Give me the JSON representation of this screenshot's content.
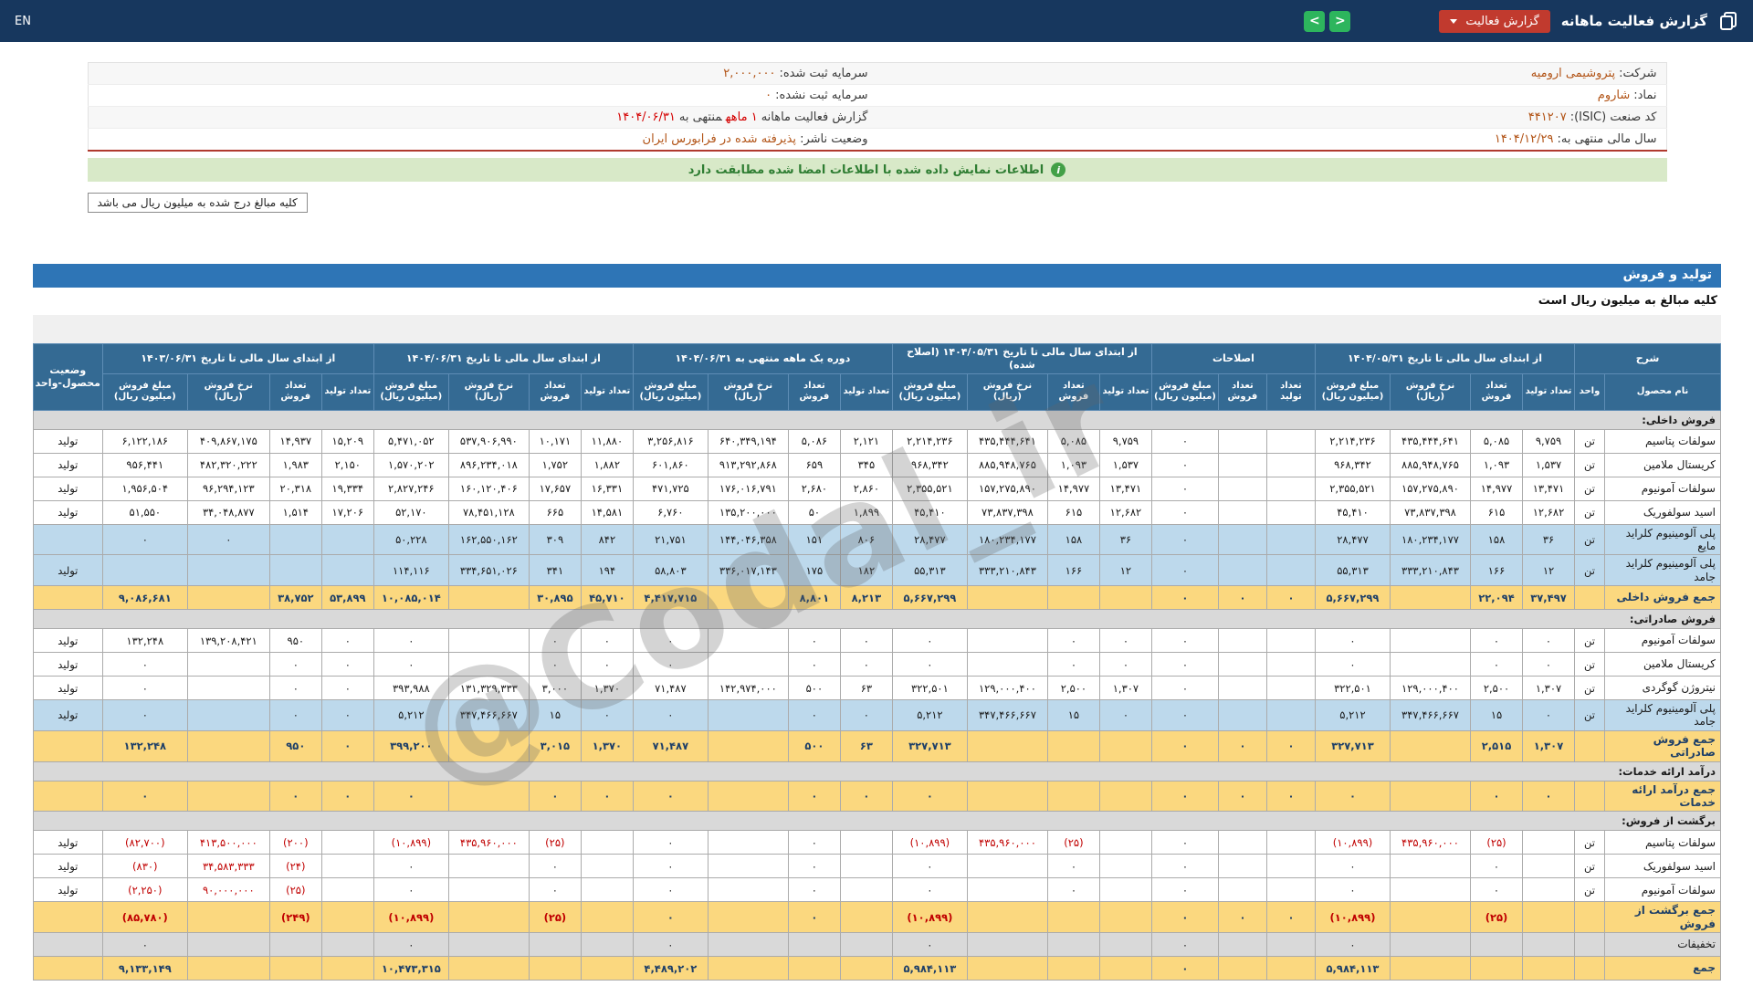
{
  "navbar": {
    "title": "گزارش فعالیت ماهانه",
    "report_dropdown_label": "گزارش فعالیت",
    "prev_arrow": "<",
    "next_arrow": ">",
    "language": "EN"
  },
  "info_panel": {
    "rows": [
      {
        "right_label": "شرکت:",
        "right_value": "پتروشیمی ارومیه",
        "left_label": "سرمایه ثبت شده:",
        "left_value": "۲,۰۰۰,۰۰۰"
      },
      {
        "right_label": "نماد:",
        "right_value": "شاروم",
        "left_label": "سرمایه ثبت نشده:",
        "left_value": "۰"
      },
      {
        "right_label": "کد صنعت (ISIC):",
        "right_value": "۴۴۱۲۰۷",
        "left_label": "گزارش فعالیت ماهانه",
        "left_highlight": "۱ ماهه",
        "left_mid": "منتهی به",
        "left_value": "۱۴۰۴/۰۶/۳۱"
      },
      {
        "right_label": "سال مالی منتهی به:",
        "right_value": "۱۴۰۴/۱۲/۲۹",
        "left_label": "وضعیت ناشر:",
        "left_value": "پذیرفته شده در فرابورس ایران"
      }
    ]
  },
  "notice": {
    "text": "اطلاعات نمایش داده شده با اطلاعات امضا شده مطابقت دارد"
  },
  "amounts_note": "کلیه مبالغ درج شده به میلیون ریال می باشد",
  "section": {
    "title": "تولید و فروش",
    "subtitle": "کلیه مبالغ به میلیون ریال است"
  },
  "watermark": "@Codal_ir",
  "colors": {
    "navbar": "#17375e",
    "dropdown_red": "#c13a2e",
    "nav_green": "#2db55d",
    "notice_green_bg": "#d8e9c8",
    "value_orange": "#b25417",
    "highlight_red": "#d40000",
    "negative_red": "#c00000",
    "table_header_blue": "#346a93",
    "section_blue": "#2e75b6",
    "sum_row_yellow": "#fbd87f",
    "pac_row_blue": "#bdd9ec",
    "section_row_gray": "#d9d9d9"
  },
  "table": {
    "corner": "شرح",
    "corner_cols": [
      "نام محصول",
      "واحد"
    ],
    "status_header": "وضعیت محصول-واحد",
    "groups": [
      {
        "label": "از ابتدای سال مالی تا تاریخ ۱۴۰۴/۰۵/۳۱",
        "cols": [
          "تعداد تولید",
          "تعداد فروش",
          "نرخ فروش (ریال)",
          "مبلغ فروش (میلیون ریال)"
        ]
      },
      {
        "label": "اصلاحات",
        "cols": [
          "تعداد تولید",
          "تعداد فروش",
          "مبلغ فروش (میلیون ریال)"
        ]
      },
      {
        "label": "از ابتدای سال مالی تا تاریخ ۱۴۰۴/۰۵/۳۱ (اصلاح شده)",
        "cols": [
          "تعداد تولید",
          "تعداد فروش",
          "نرخ فروش (ریال)",
          "مبلغ فروش (میلیون ریال)"
        ]
      },
      {
        "label": "دوره یک ماهه منتهی به ۱۴۰۴/۰۶/۳۱",
        "cols": [
          "تعداد تولید",
          "تعداد فروش",
          "نرخ فروش (ریال)",
          "مبلغ فروش (میلیون ریال)"
        ]
      },
      {
        "label": "از ابتدای سال مالی تا تاریخ ۱۴۰۴/۰۶/۳۱",
        "cols": [
          "تعداد تولید",
          "تعداد فروش",
          "نرخ فروش (ریال)",
          "مبلغ فروش (میلیون ریال)"
        ]
      },
      {
        "label": "از ابتدای سال مالی تا تاریخ ۱۴۰۳/۰۶/۳۱",
        "cols": [
          "تعداد تولید",
          "تعداد فروش",
          "نرخ فروش (ریال)",
          "مبلغ فروش (میلیون ریال)"
        ]
      }
    ],
    "rows": [
      {
        "type": "section",
        "label": "فروش داخلی:"
      },
      {
        "type": "product",
        "style": "normal",
        "name": "سولفات پتاسیم",
        "unit": "تن",
        "status": "تولید",
        "cells": [
          "۹,۷۵۹",
          "۵,۰۸۵",
          "۴۳۵,۴۴۴,۶۴۱",
          "۲,۲۱۴,۲۳۶",
          "",
          "",
          "۰",
          "۹,۷۵۹",
          "۵,۰۸۵",
          "۴۳۵,۴۴۴,۶۴۱",
          "۲,۲۱۴,۲۳۶",
          "۲,۱۲۱",
          "۵,۰۸۶",
          "۶۴۰,۳۴۹,۱۹۴",
          "۳,۲۵۶,۸۱۶",
          "۱۱,۸۸۰",
          "۱۰,۱۷۱",
          "۵۳۷,۹۰۶,۹۹۰",
          "۵,۴۷۱,۰۵۲",
          "۱۵,۲۰۹",
          "۱۴,۹۳۷",
          "۴۰۹,۸۶۷,۱۷۵",
          "۶,۱۲۲,۱۸۶"
        ]
      },
      {
        "type": "product",
        "style": "normal",
        "name": "کریستال ملامین",
        "unit": "تن",
        "status": "تولید",
        "cells": [
          "۱,۵۳۷",
          "۱,۰۹۳",
          "۸۸۵,۹۴۸,۷۶۵",
          "۹۶۸,۳۴۲",
          "",
          "",
          "۰",
          "۱,۵۳۷",
          "۱,۰۹۳",
          "۸۸۵,۹۴۸,۷۶۵",
          "۹۶۸,۳۴۲",
          "۳۴۵",
          "۶۵۹",
          "۹۱۳,۲۹۲,۸۶۸",
          "۶۰۱,۸۶۰",
          "۱,۸۸۲",
          "۱,۷۵۲",
          "۸۹۶,۲۳۴,۰۱۸",
          "۱,۵۷۰,۲۰۲",
          "۲,۱۵۰",
          "۱,۹۸۳",
          "۴۸۲,۳۲۰,۲۲۲",
          "۹۵۶,۴۴۱"
        ]
      },
      {
        "type": "product",
        "style": "normal",
        "name": "سولفات آمونیوم",
        "unit": "تن",
        "status": "تولید",
        "cells": [
          "۱۳,۴۷۱",
          "۱۴,۹۷۷",
          "۱۵۷,۲۷۵,۸۹۰",
          "۲,۳۵۵,۵۲۱",
          "",
          "",
          "۰",
          "۱۳,۴۷۱",
          "۱۴,۹۷۷",
          "۱۵۷,۲۷۵,۸۹۰",
          "۲,۳۵۵,۵۲۱",
          "۲,۸۶۰",
          "۲,۶۸۰",
          "۱۷۶,۰۱۶,۷۹۱",
          "۴۷۱,۷۲۵",
          "۱۶,۳۳۱",
          "۱۷,۶۵۷",
          "۱۶۰,۱۲۰,۴۰۶",
          "۲,۸۲۷,۲۴۶",
          "۱۹,۳۳۴",
          "۲۰,۳۱۸",
          "۹۶,۲۹۴,۱۲۳",
          "۱,۹۵۶,۵۰۴"
        ]
      },
      {
        "type": "product",
        "style": "normal",
        "name": "اسید سولفوریک",
        "unit": "تن",
        "status": "تولید",
        "cells": [
          "۱۲,۶۸۲",
          "۶۱۵",
          "۷۳,۸۳۷,۳۹۸",
          "۴۵,۴۱۰",
          "",
          "",
          "۰",
          "۱۲,۶۸۲",
          "۶۱۵",
          "۷۳,۸۳۷,۳۹۸",
          "۴۵,۴۱۰",
          "۱,۸۹۹",
          "۵۰",
          "۱۳۵,۲۰۰,۰۰۰",
          "۶,۷۶۰",
          "۱۴,۵۸۱",
          "۶۶۵",
          "۷۸,۴۵۱,۱۲۸",
          "۵۲,۱۷۰",
          "۱۷,۲۰۶",
          "۱,۵۱۴",
          "۳۴,۰۴۸,۸۷۷",
          "۵۱,۵۵۰"
        ]
      },
      {
        "type": "product",
        "style": "blue",
        "name": "پلی آلومینیوم کلراید مایع",
        "unit": "تن",
        "status": "",
        "cells": [
          "۳۶",
          "۱۵۸",
          "۱۸۰,۲۳۴,۱۷۷",
          "۲۸,۴۷۷",
          "",
          "",
          "۰",
          "۳۶",
          "۱۵۸",
          "۱۸۰,۲۳۴,۱۷۷",
          "۲۸,۴۷۷",
          "۸۰۶",
          "۱۵۱",
          "۱۴۴,۰۴۶,۳۵۸",
          "۲۱,۷۵۱",
          "۸۴۲",
          "۳۰۹",
          "۱۶۲,۵۵۰,۱۶۲",
          "۵۰,۲۲۸",
          "",
          "",
          "۰",
          "۰"
        ]
      },
      {
        "type": "product",
        "style": "blue",
        "name": "پلی آلومینیوم کلراید جامد",
        "unit": "تن",
        "status": "تولید",
        "cells": [
          "۱۲",
          "۱۶۶",
          "۳۳۳,۲۱۰,۸۴۳",
          "۵۵,۳۱۳",
          "",
          "",
          "۰",
          "۱۲",
          "۱۶۶",
          "۳۳۳,۲۱۰,۸۴۳",
          "۵۵,۳۱۳",
          "۱۸۲",
          "۱۷۵",
          "۳۳۶,۰۱۷,۱۴۳",
          "۵۸,۸۰۳",
          "۱۹۴",
          "۳۴۱",
          "۳۳۴,۶۵۱,۰۲۶",
          "۱۱۴,۱۱۶",
          "",
          "",
          "",
          ""
        ]
      },
      {
        "type": "product",
        "style": "yellow",
        "name": "جمع فروش داخلی",
        "unit": "",
        "status": "",
        "cells": [
          "۳۷,۴۹۷",
          "۲۲,۰۹۴",
          "",
          "۵,۶۶۷,۲۹۹",
          "۰",
          "۰",
          "۰",
          "",
          "",
          "",
          "۵,۶۶۷,۲۹۹",
          "۸,۲۱۳",
          "۸,۸۰۱",
          "",
          "۴,۴۱۷,۷۱۵",
          "۴۵,۷۱۰",
          "۳۰,۸۹۵",
          "",
          "۱۰,۰۸۵,۰۱۴",
          "۵۳,۸۹۹",
          "۳۸,۷۵۲",
          "",
          "۹,۰۸۶,۶۸۱"
        ]
      },
      {
        "type": "section",
        "label": "فروش صادراتی:"
      },
      {
        "type": "product",
        "style": "normal",
        "name": "سولفات آمونیوم",
        "unit": "تن",
        "status": "تولید",
        "cells": [
          "۰",
          "۰",
          "",
          "۰",
          "",
          "",
          "۰",
          "۰",
          "۰",
          "",
          "۰",
          "۰",
          "۰",
          "",
          "۰",
          "۰",
          "۰",
          "",
          "۰",
          "۰",
          "۹۵۰",
          "۱۳۹,۲۰۸,۴۲۱",
          "۱۳۲,۲۴۸"
        ]
      },
      {
        "type": "product",
        "style": "normal",
        "name": "کریستال ملامین",
        "unit": "تن",
        "status": "تولید",
        "cells": [
          "۰",
          "۰",
          "",
          "۰",
          "",
          "",
          "۰",
          "۰",
          "۰",
          "",
          "۰",
          "۰",
          "۰",
          "",
          "۰",
          "۰",
          "۰",
          "",
          "۰",
          "۰",
          "۰",
          "",
          "۰"
        ]
      },
      {
        "type": "product",
        "style": "normal",
        "name": "نیتروژن گوگردی",
        "unit": "تن",
        "status": "تولید",
        "cells": [
          "۱,۳۰۷",
          "۲,۵۰۰",
          "۱۲۹,۰۰۰,۴۰۰",
          "۳۲۲,۵۰۱",
          "",
          "",
          "۰",
          "۱,۳۰۷",
          "۲,۵۰۰",
          "۱۲۹,۰۰۰,۴۰۰",
          "۳۲۲,۵۰۱",
          "۶۳",
          "۵۰۰",
          "۱۴۲,۹۷۴,۰۰۰",
          "۷۱,۴۸۷",
          "۱,۳۷۰",
          "۳,۰۰۰",
          "۱۳۱,۳۲۹,۳۳۳",
          "۳۹۳,۹۸۸",
          "۰",
          "۰",
          "",
          "۰"
        ]
      },
      {
        "type": "product",
        "style": "blue",
        "name": "پلی آلومینیوم کلراید جامد",
        "unit": "تن",
        "status": "تولید",
        "cells": [
          "۰",
          "۱۵",
          "۳۴۷,۴۶۶,۶۶۷",
          "۵,۲۱۲",
          "",
          "",
          "۰",
          "۰",
          "۱۵",
          "۳۴۷,۴۶۶,۶۶۷",
          "۵,۲۱۲",
          "۰",
          "۰",
          "",
          "۰",
          "۰",
          "۱۵",
          "۳۴۷,۴۶۶,۶۶۷",
          "۵,۲۱۲",
          "۰",
          "۰",
          "",
          "۰"
        ]
      },
      {
        "type": "product",
        "style": "yellow",
        "name": "جمع فروش صادراتی",
        "unit": "",
        "status": "",
        "cells": [
          "۱,۳۰۷",
          "۲,۵۱۵",
          "",
          "۳۲۷,۷۱۳",
          "۰",
          "۰",
          "۰",
          "",
          "",
          "",
          "۳۲۷,۷۱۳",
          "۶۳",
          "۵۰۰",
          "",
          "۷۱,۴۸۷",
          "۱,۳۷۰",
          "۳,۰۱۵",
          "",
          "۳۹۹,۲۰۰",
          "۰",
          "۹۵۰",
          "",
          "۱۳۲,۲۴۸"
        ]
      },
      {
        "type": "section",
        "label": "درآمد ارائه خدمات:"
      },
      {
        "type": "product",
        "style": "yellow",
        "name": "جمع درآمد ارائه خدمات",
        "unit": "",
        "status": "",
        "cells": [
          "۰",
          "۰",
          "",
          "۰",
          "۰",
          "۰",
          "۰",
          "",
          "",
          "",
          "۰",
          "۰",
          "۰",
          "",
          "۰",
          "۰",
          "۰",
          "",
          "۰",
          "۰",
          "۰",
          "",
          "۰"
        ]
      },
      {
        "type": "section",
        "label": "برگشت از فروش:"
      },
      {
        "type": "product",
        "style": "normal",
        "red": true,
        "name": "سولفات پتاسیم",
        "unit": "تن",
        "status": "تولید",
        "cells": [
          "",
          "(۲۵)",
          "۴۳۵,۹۶۰,۰۰۰",
          "(۱۰,۸۹۹)",
          "",
          "",
          "۰",
          "",
          "(۲۵)",
          "۴۳۵,۹۶۰,۰۰۰",
          "(۱۰,۸۹۹)",
          "",
          "۰",
          "",
          "۰",
          "",
          "(۲۵)",
          "۴۳۵,۹۶۰,۰۰۰",
          "(۱۰,۸۹۹)",
          "",
          "(۲۰۰)",
          "۴۱۳,۵۰۰,۰۰۰",
          "(۸۲,۷۰۰)"
        ]
      },
      {
        "type": "product",
        "style": "normal",
        "red": true,
        "name": "اسید سولفوریک",
        "unit": "تن",
        "status": "تولید",
        "cells": [
          "",
          "۰",
          "",
          "۰",
          "",
          "",
          "۰",
          "",
          "۰",
          "",
          "۰",
          "",
          "۰",
          "",
          "۰",
          "",
          "۰",
          "",
          "۰",
          "",
          "(۲۴)",
          "۳۴,۵۸۳,۳۳۳",
          "(۸۳۰)"
        ]
      },
      {
        "type": "product",
        "style": "normal",
        "red": true,
        "name": "سولفات آمونیوم",
        "unit": "تن",
        "status": "تولید",
        "cells": [
          "",
          "۰",
          "",
          "۰",
          "",
          "",
          "۰",
          "",
          "۰",
          "",
          "۰",
          "",
          "۰",
          "",
          "۰",
          "",
          "۰",
          "",
          "۰",
          "",
          "(۲۵)",
          "۹۰,۰۰۰,۰۰۰",
          "(۲,۲۵۰)"
        ]
      },
      {
        "type": "product",
        "style": "yellow",
        "red": true,
        "name": "جمع برگشت از فروش",
        "unit": "",
        "status": "",
        "cells": [
          "",
          "(۲۵)",
          "",
          "(۱۰,۸۹۹)",
          "۰",
          "۰",
          "۰",
          "",
          "",
          "",
          "(۱۰,۸۹۹)",
          "",
          "۰",
          "",
          "۰",
          "",
          "(۲۵)",
          "",
          "(۱۰,۸۹۹)",
          "",
          "(۲۴۹)",
          "",
          "(۸۵,۷۸۰)"
        ]
      },
      {
        "type": "product",
        "style": "gray",
        "name": "تخفیفات",
        "unit": "",
        "status": "",
        "cells": [
          "",
          "",
          "",
          "۰",
          "",
          "",
          "۰",
          "",
          "",
          "",
          "۰",
          "",
          "",
          "",
          "۰",
          "",
          "",
          "",
          "۰",
          "",
          "",
          "",
          "۰"
        ]
      },
      {
        "type": "product",
        "style": "yellow",
        "name": "جمع",
        "unit": "",
        "status": "",
        "cells": [
          "",
          "",
          "",
          "۵,۹۸۴,۱۱۳",
          "",
          "",
          "۰",
          "",
          "",
          "",
          "۵,۹۸۴,۱۱۳",
          "",
          "",
          "",
          "۴,۴۸۹,۲۰۲",
          "",
          "",
          "",
          "۱۰,۴۷۳,۳۱۵",
          "",
          "",
          "",
          "۹,۱۳۳,۱۴۹"
        ]
      }
    ]
  }
}
